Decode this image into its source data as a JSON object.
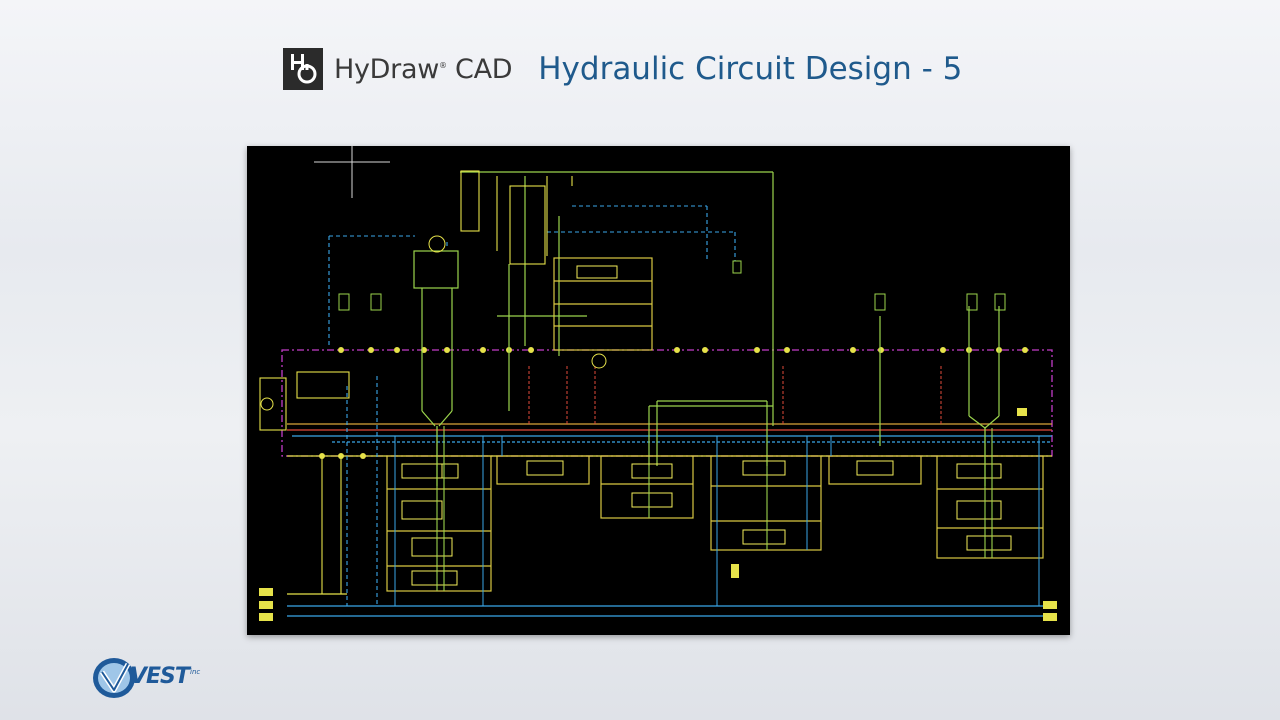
{
  "header": {
    "brand_name": "HyDraw",
    "brand_mark": "®",
    "brand_suffix": "CAD",
    "title": "Hydraulic Circuit Design - 5"
  },
  "diagram": {
    "description_icon": "hydraulic-schematic"
  },
  "footer": {
    "company": "VEST",
    "company_suffix": "inc"
  },
  "colors": {
    "title_blue": "#1f5a8c",
    "cad_background": "#000000",
    "line_yellow": "#e6e24a",
    "line_green": "#9bd44c",
    "line_magenta": "#c23cc8",
    "line_blue": "#3aa6e8",
    "line_red": "#e04a3a"
  }
}
